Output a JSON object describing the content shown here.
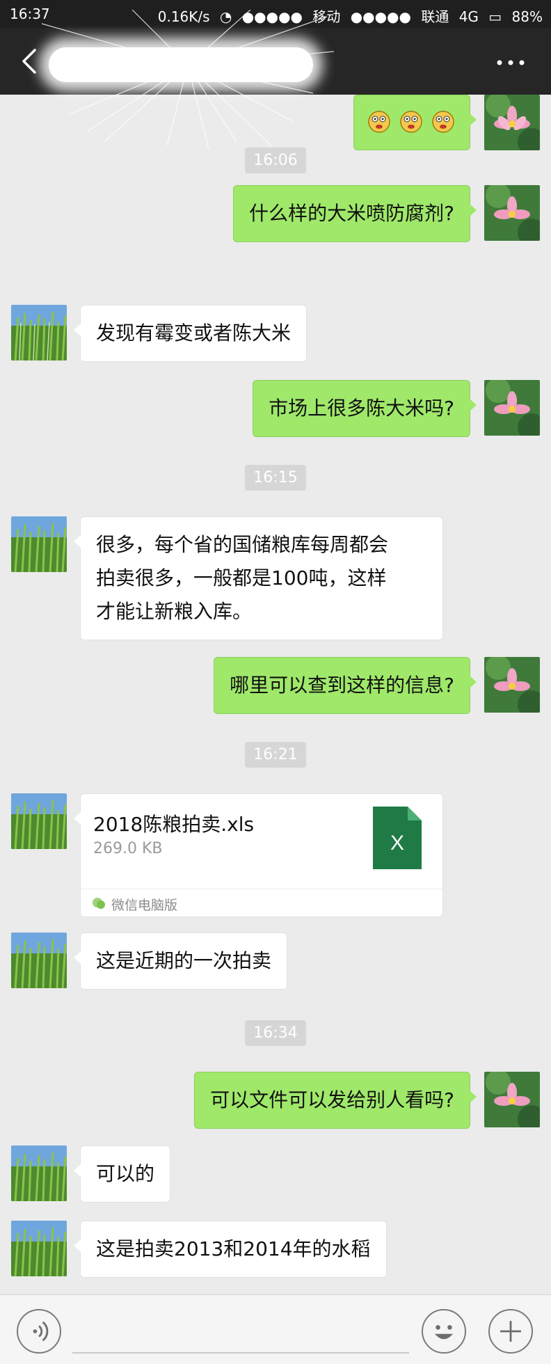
{
  "status_bar": {
    "time": "16:37",
    "network_speed": "0.16K/s",
    "carrier1": "移动",
    "carrier2": "联通",
    "network_type": "4G",
    "battery": "88%"
  },
  "header": {
    "back_icon": "chevron-left-icon",
    "more_icon": "more-dots-icon"
  },
  "colors": {
    "sent_bubble": "#9fe86a",
    "received_bubble": "#ffffff",
    "chat_background": "#ebebeb",
    "header_background": "#262626",
    "excel_green": "#1f7a45"
  },
  "timestamps": [
    "16:06",
    "16:15",
    "16:21",
    "16:34"
  ],
  "messages": [
    {
      "from": "me",
      "text": "什么样的大米喷防腐剂?"
    },
    {
      "from": "them",
      "text": "发现有霉变或者陈大米"
    },
    {
      "from": "me",
      "text": "市场上很多陈大米吗?"
    },
    {
      "from": "them",
      "lines": [
        "很多，每个省的国储粮库每周都会",
        "拍卖很多，一般都是100吨，这样",
        "才能让新粮入库。"
      ]
    },
    {
      "from": "me",
      "text": "哪里可以查到这样的信息?"
    },
    {
      "from": "them",
      "text": "这是近期的一次拍卖"
    },
    {
      "from": "me",
      "text": "可以文件可以发给别人看吗?"
    },
    {
      "from": "them",
      "text": "可以的"
    },
    {
      "from": "them",
      "text": "这是拍卖2013和2014年的水稻"
    }
  ],
  "file": {
    "name": "2018陈粮拍卖.xls",
    "size": "269.0 KB",
    "icon_letter": "X",
    "source": "微信电脑版"
  },
  "input_bar": {
    "voice_icon": "voice-icon",
    "emoji_icon": "emoji-icon",
    "plus_icon": "plus-icon"
  }
}
